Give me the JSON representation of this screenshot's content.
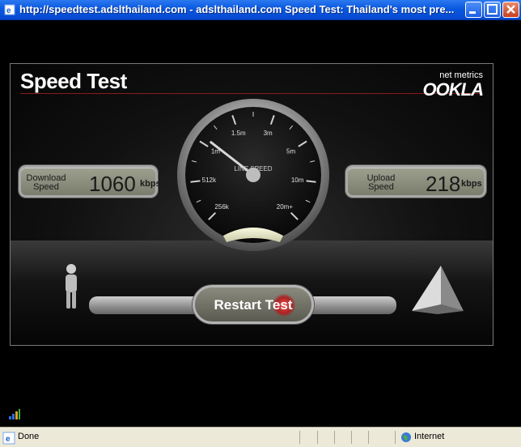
{
  "window": {
    "title": "http://speedtest.adslthailand.com - adslthailand.com Speed Test: Thailand's most pre..."
  },
  "app": {
    "title": "Speed Test",
    "brand_small": "net metrics",
    "brand_logo": "OOKLA"
  },
  "download": {
    "label_line1": "Download",
    "label_line2": "Speed",
    "value": "1060",
    "unit": "kbps"
  },
  "upload": {
    "label_line1": "Upload",
    "label_line2": "Speed",
    "value": "218",
    "unit": "kbps"
  },
  "gauge": {
    "center_label": "LINE SPEED",
    "ticks": [
      "256k",
      "512k",
      "1m",
      "1.5m",
      "3m",
      "5m",
      "10m",
      "20m+"
    ],
    "needle_kbps": 1060
  },
  "actions": {
    "restart_label": "Restart Test"
  },
  "status": {
    "text": "Done",
    "zone": "Internet"
  },
  "colors": {
    "titlebar": "#0a58e0",
    "accent_rule": "#8a1a1a",
    "glow": "#e55555"
  }
}
